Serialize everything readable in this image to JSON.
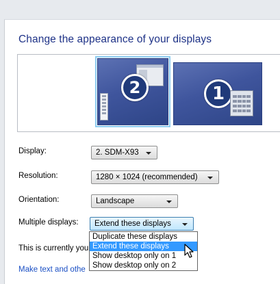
{
  "page": {
    "title": "Change the appearance of your displays"
  },
  "monitors": [
    {
      "number": "2",
      "selected": true
    },
    {
      "number": "1",
      "selected": false
    }
  ],
  "settings": {
    "display": {
      "label": "Display:",
      "value": "2. SDM-X93"
    },
    "resolution": {
      "label": "Resolution:",
      "value": "1280 × 1024 (recommended)"
    },
    "orientation": {
      "label": "Orientation:",
      "value": "Landscape"
    },
    "multiple_displays": {
      "label": "Multiple displays:",
      "value": "Extend these displays",
      "options": [
        "Duplicate these displays",
        "Extend these displays",
        "Show desktop only on 1",
        "Show desktop only on 2"
      ],
      "highlighted_option": "Extend these displays"
    }
  },
  "status_text": "This is currently you",
  "link_text": "Make text and othe",
  "colors": {
    "title": "#1e3287",
    "link": "#1a4fc4",
    "selection": "#3399ff",
    "monitor_selected_outline": "#8ecdf0"
  }
}
